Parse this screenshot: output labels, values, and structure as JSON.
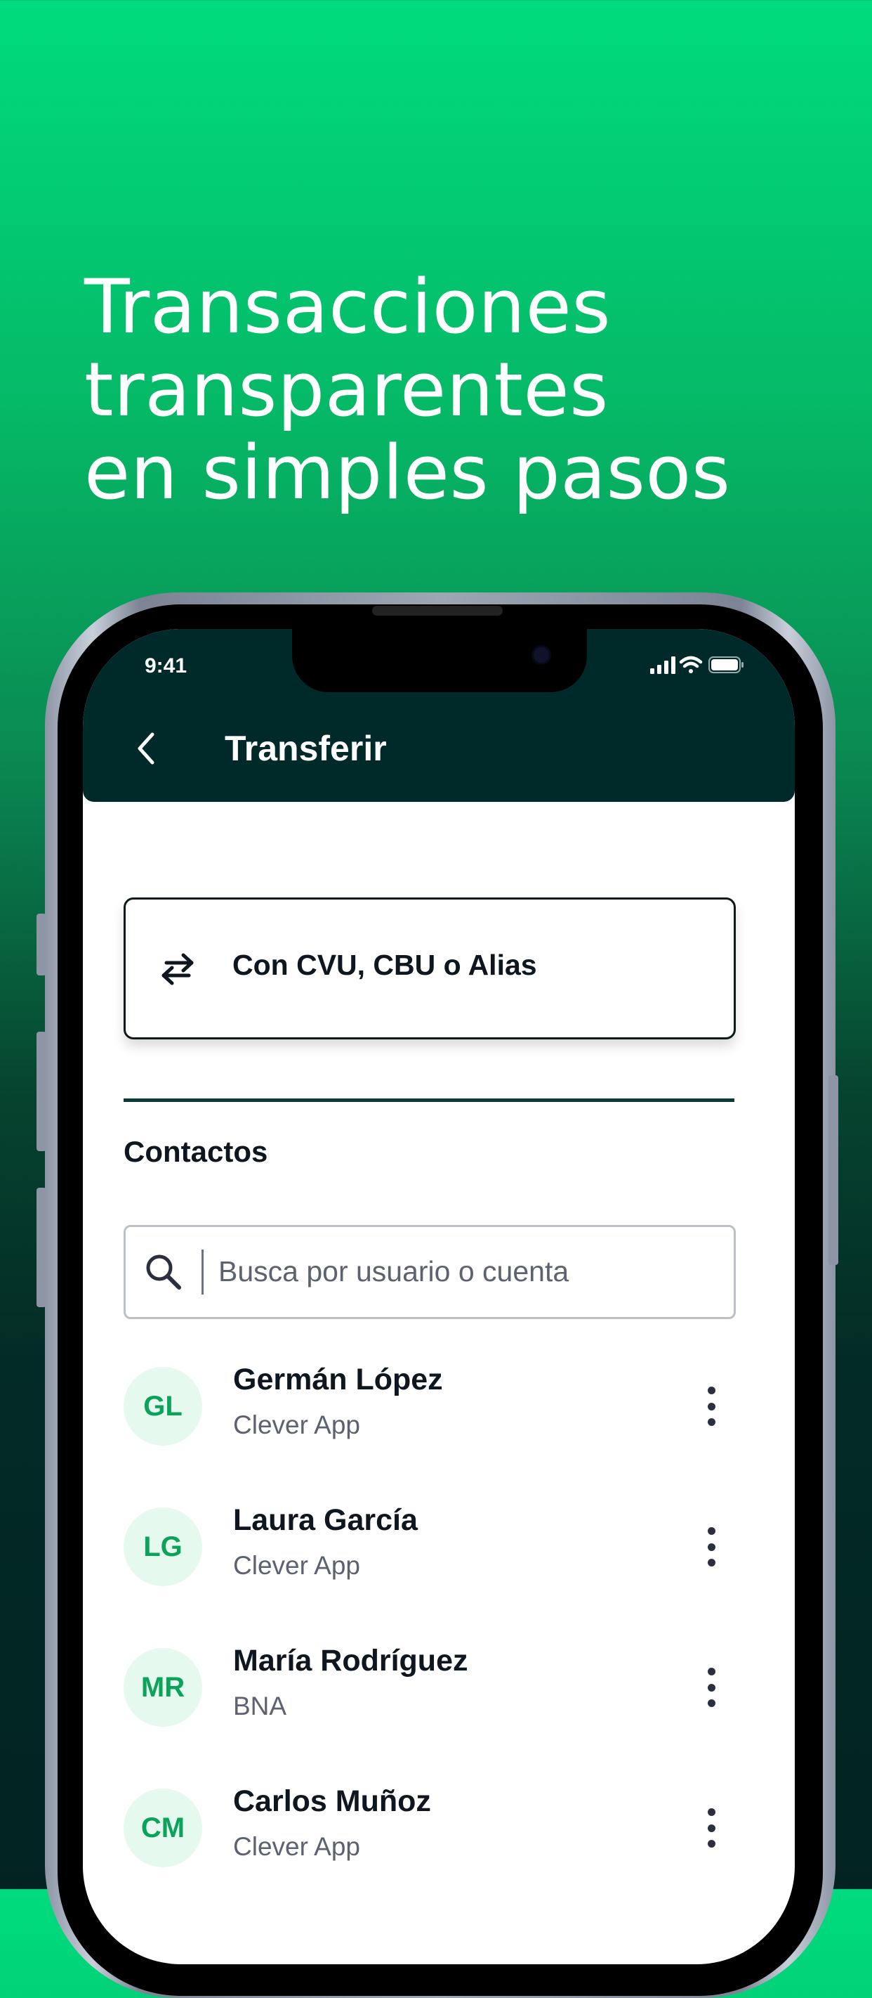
{
  "hero": {
    "headline_lines": [
      "Transacciones",
      "transparentes",
      "en simples pasos"
    ]
  },
  "status_bar": {
    "time": "9:41",
    "icons": [
      "signal-icon",
      "wifi-icon",
      "battery-icon"
    ]
  },
  "app_bar": {
    "back_icon": "chevron-left-icon",
    "title": "Transferir"
  },
  "transfer_option": {
    "icon": "swap-arrows-icon",
    "label": "Con CVU, CBU o Alias"
  },
  "contacts": {
    "section_title": "Contactos",
    "search": {
      "icon": "search-icon",
      "placeholder": "Busca por usuario o cuenta",
      "value": ""
    },
    "items": [
      {
        "initials": "GL",
        "name": "Germán López",
        "bank": "Clever App"
      },
      {
        "initials": "LG",
        "name": "Laura García",
        "bank": "Clever App"
      },
      {
        "initials": "MR",
        "name": "María Rodríguez",
        "bank": "BNA"
      },
      {
        "initials": "CM",
        "name": "Carlos Muñoz",
        "bank": "Clever App"
      }
    ]
  },
  "colors": {
    "gradient_top": "#00DB7E",
    "gradient_bottom": "#022322",
    "app_bar": "#00292A",
    "avatar_bg": "#E6F9EF",
    "avatar_text": "#0BA35A",
    "text_primary": "#0E1620",
    "text_secondary": "#5D6270"
  }
}
